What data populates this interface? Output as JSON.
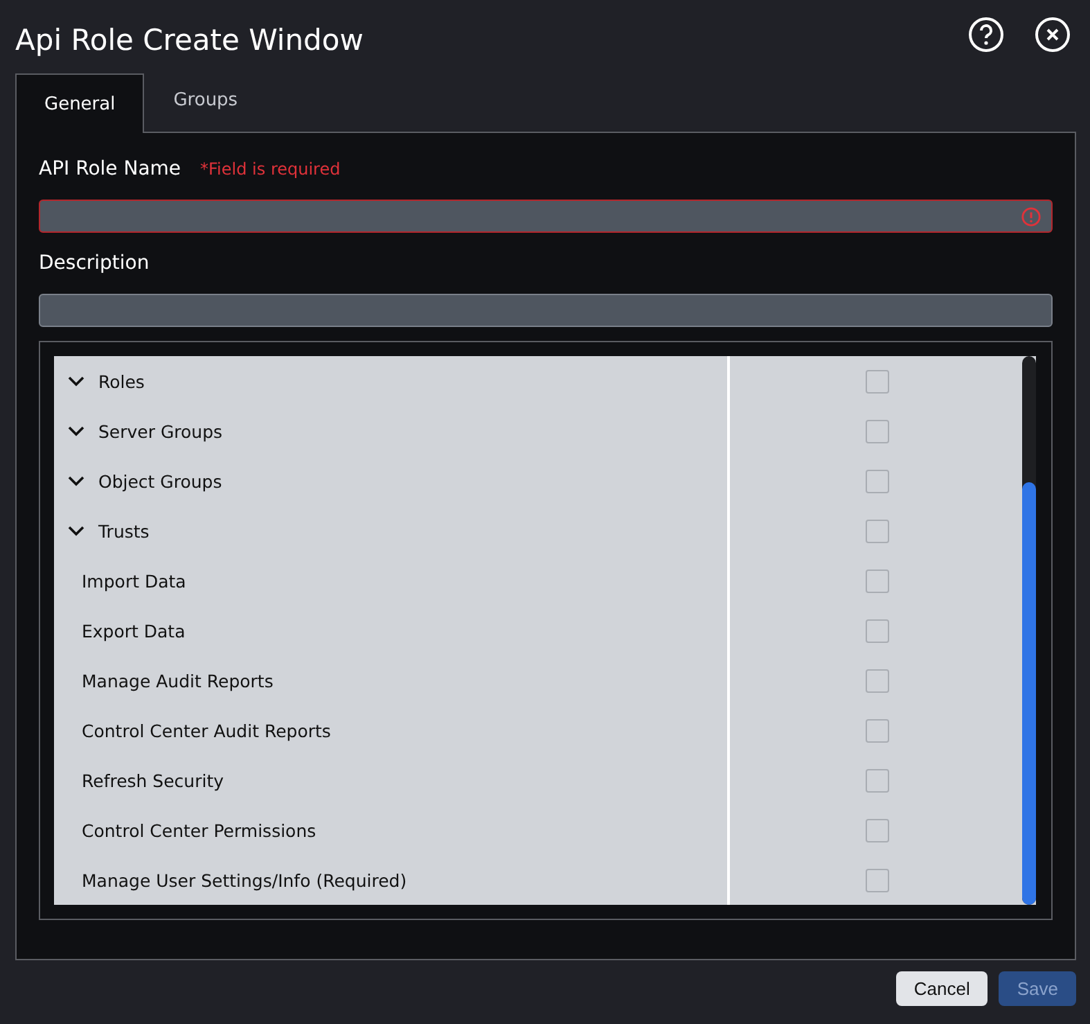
{
  "window": {
    "title": "Api Role Create Window"
  },
  "tabs": [
    {
      "label": "General",
      "selected": true
    },
    {
      "label": "Groups",
      "selected": false
    }
  ],
  "name_field": {
    "label": "API Role Name",
    "error": "*Field is required",
    "invalid": true
  },
  "description_field": {
    "label": "Description",
    "invalid": false
  },
  "tree": [
    {
      "label": "Roles",
      "expanded": true,
      "checked": false
    },
    {
      "label": "Server Groups",
      "expanded": true,
      "checked": false
    },
    {
      "label": "Object Groups",
      "expanded": true,
      "checked": false
    },
    {
      "label": "Trusts",
      "expanded": true,
      "checked": false,
      "children": [
        {
          "label": "Import Data",
          "checked": false
        },
        {
          "label": "Export Data",
          "checked": false
        },
        {
          "label": "Manage Audit Reports",
          "checked": false
        },
        {
          "label": "Control Center Audit Reports",
          "checked": false
        },
        {
          "label": "Refresh Security",
          "checked": false
        },
        {
          "label": "Control Center Permissions",
          "checked": false
        },
        {
          "label": "Manage User Settings/Info (Required)",
          "checked": false
        }
      ]
    }
  ],
  "buttons": [
    {
      "label": "Cancel",
      "kind": "secondary",
      "disabled": false
    },
    {
      "label": "Save",
      "kind": "primary",
      "disabled": true
    }
  ]
}
